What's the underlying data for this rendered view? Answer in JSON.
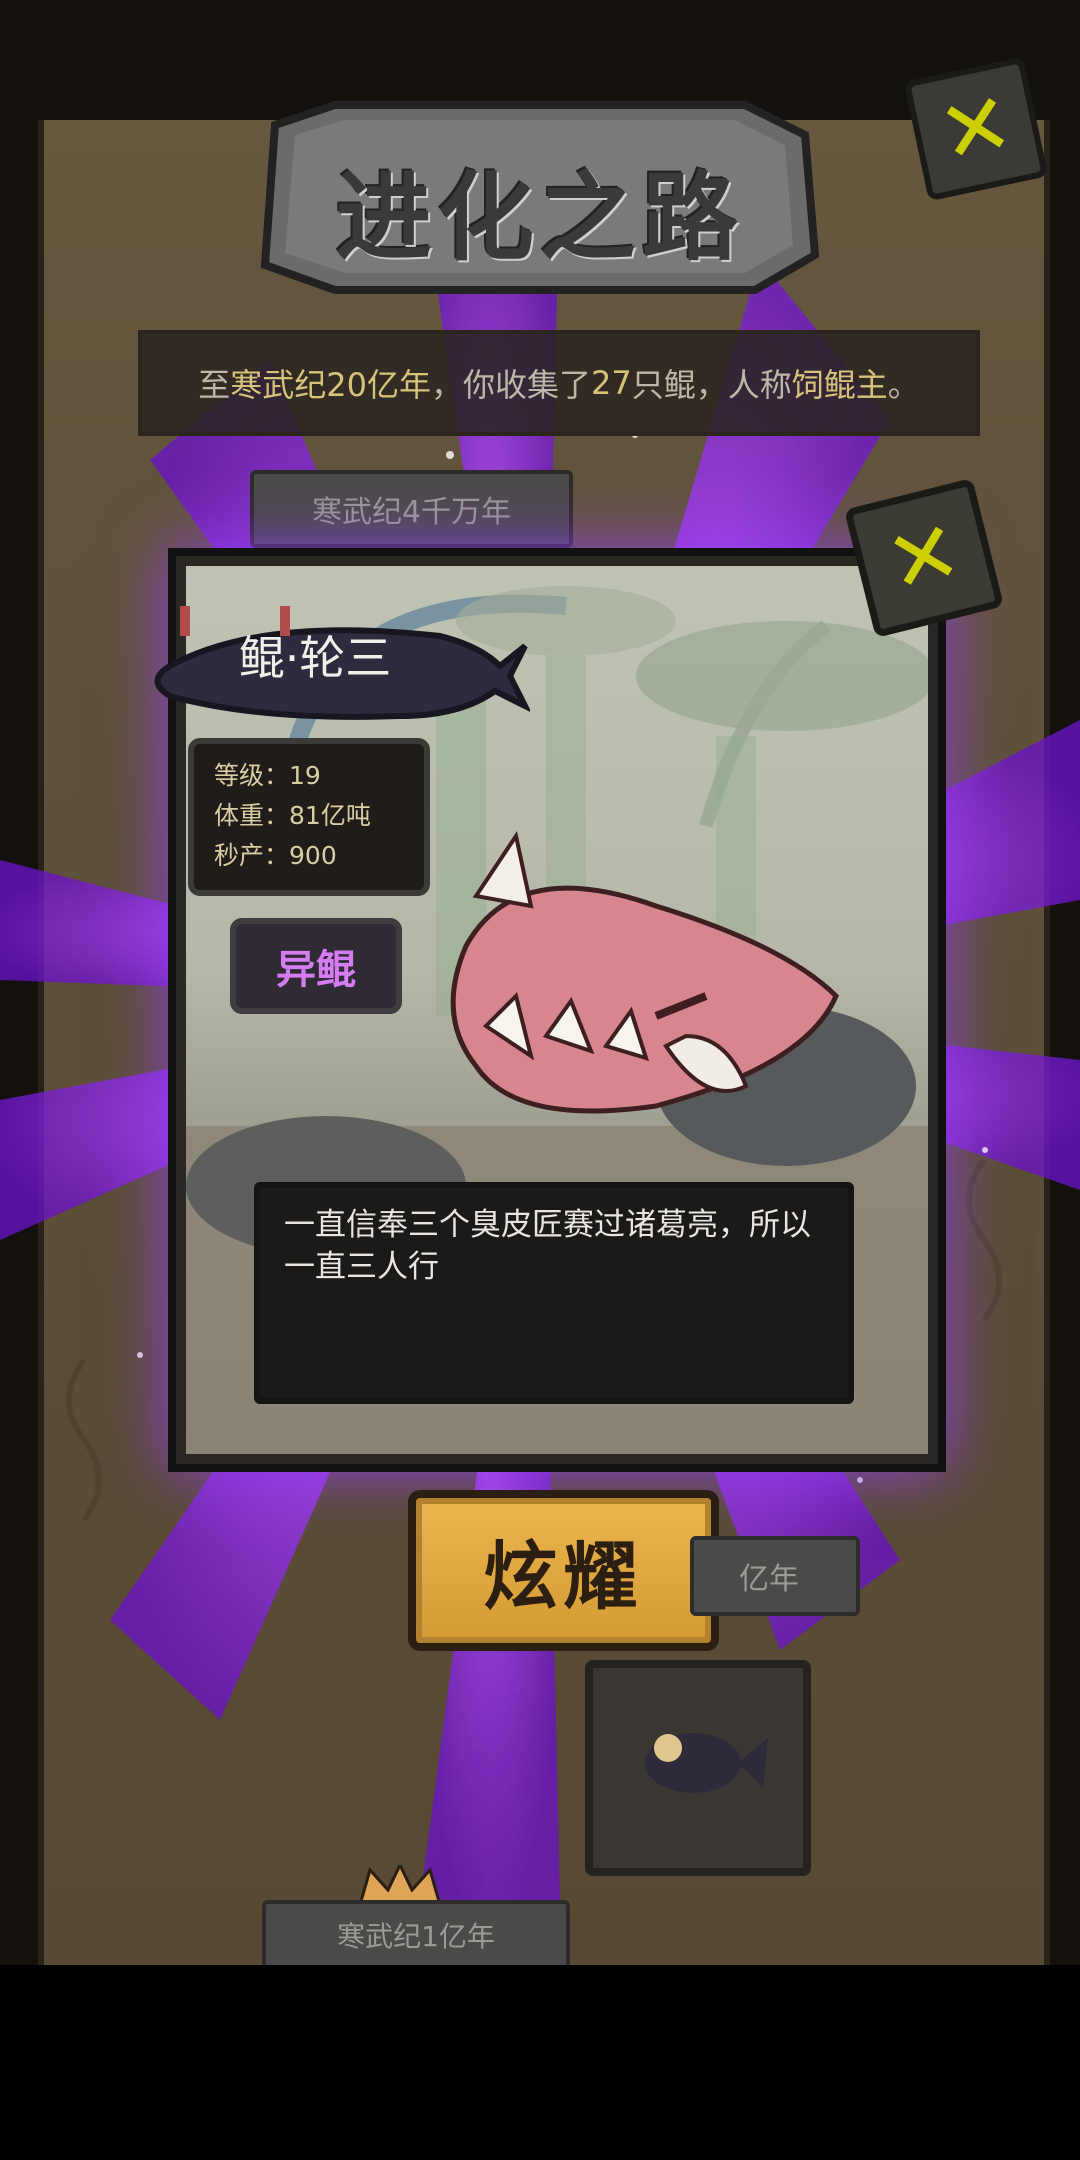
{
  "header": {
    "title": "进化之路",
    "close_label": "✕"
  },
  "banner": {
    "prefix": "至",
    "era": "寒武纪20亿年",
    "mid": "，你收集了",
    "count": "27",
    "mid2": "只鲲，人称",
    "title": "饲鲲主",
    "suffix": "。"
  },
  "timeline": {
    "era_top": "寒武纪4千万年",
    "era_mid": "亿年",
    "era_bottom": "寒武纪1亿年"
  },
  "popup": {
    "close_label": "✕",
    "name": "鲲·轮三",
    "stats": [
      {
        "label": "等级：",
        "value": "19"
      },
      {
        "label": "体重：",
        "value": "81亿吨"
      },
      {
        "label": "秒产：",
        "value": "900"
      }
    ],
    "tag": "异鲲",
    "description": "一直信奉三个臭皮匠赛过诸葛亮，所以一直三人行"
  },
  "actions": {
    "show_off": "炫耀"
  },
  "colors": {
    "accent_purple": "#8a2be2",
    "tag_text": "#d57cf2",
    "highlight_text": "#d7c27a",
    "button_gold": "#e2a842",
    "close_yellow": "#cdd000"
  }
}
